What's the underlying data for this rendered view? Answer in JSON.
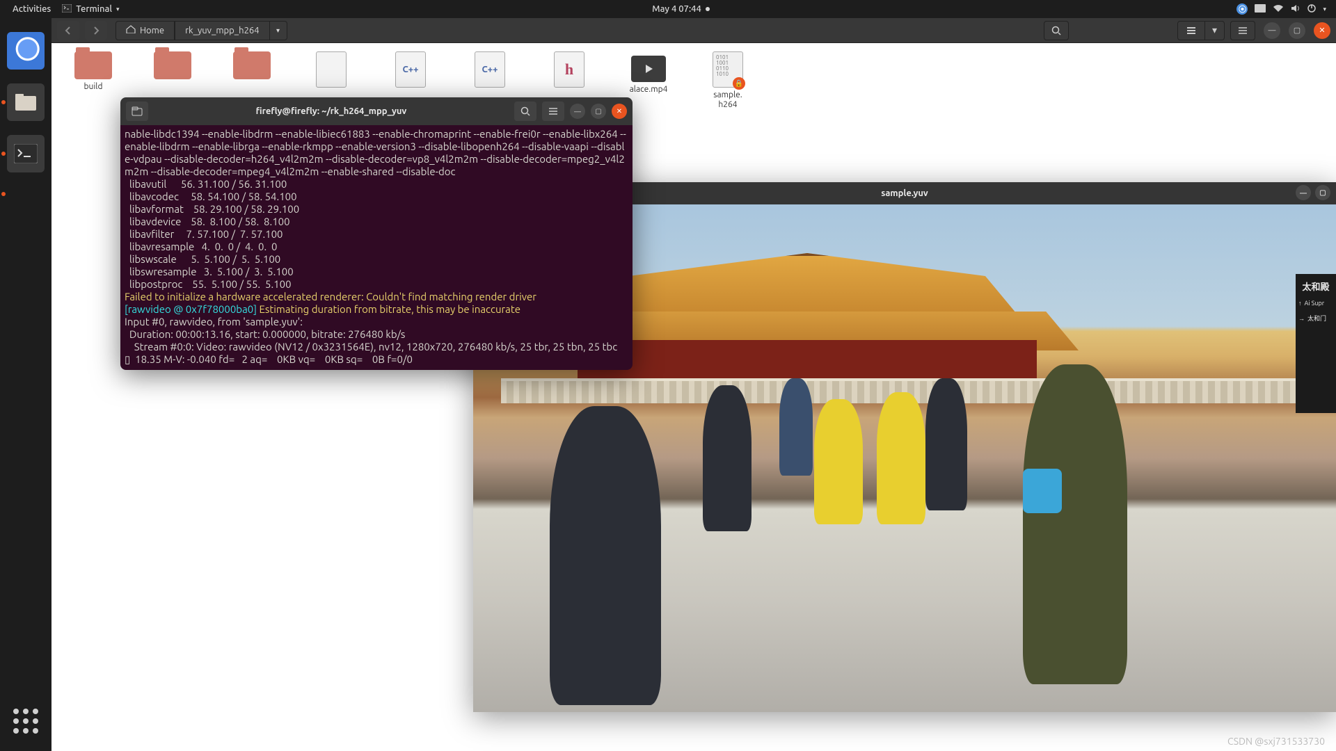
{
  "panel": {
    "activities": "Activities",
    "app_menu": "Terminal",
    "clock": "May 4  07:44"
  },
  "fm": {
    "home_label": "Home",
    "path_label": "rk_yuv_mpp_h264",
    "files": [
      {
        "name": "build",
        "kind": "folder"
      },
      {
        "name": "",
        "kind": "folder"
      },
      {
        "name": "",
        "kind": "folder"
      },
      {
        "name": "",
        "kind": "doc",
        "badge": ""
      },
      {
        "name": "",
        "kind": "cpp",
        "badge": "C++"
      },
      {
        "name": "",
        "kind": "cpp",
        "badge": "C++"
      },
      {
        "name": "",
        "kind": "h",
        "badge": "h"
      },
      {
        "name": "alace.mp4",
        "kind": "video"
      },
      {
        "name": "sample.\nh264",
        "kind": "bin"
      }
    ]
  },
  "terminal": {
    "title": "firefly@firefly: ~/rk_h264_mpp_yuv",
    "lines": [
      {
        "c": "",
        "t": "nable-libdc1394 --enable-libdrm --enable-libiec61883 --enable-chromaprint --enable-frei0r --enable-libx264 --enable-libdrm --enable-librga --enable-rkmpp --enable-version3 --disable-libopenh264 --disable-vaapi --disable-vdpau --disable-decoder=h264_v4l2m2m --disable-decoder=vp8_v4l2m2m --disable-decoder=mpeg2_v4l2m2m --disable-decoder=mpeg4_v4l2m2m --enable-shared --disable-doc"
      },
      {
        "c": "",
        "t": "  libavutil      56. 31.100 / 56. 31.100"
      },
      {
        "c": "",
        "t": "  libavcodec     58. 54.100 / 58. 54.100"
      },
      {
        "c": "",
        "t": "  libavformat    58. 29.100 / 58. 29.100"
      },
      {
        "c": "",
        "t": "  libavdevice    58.  8.100 / 58.  8.100"
      },
      {
        "c": "",
        "t": "  libavfilter     7. 57.100 /  7. 57.100"
      },
      {
        "c": "",
        "t": "  libavresample   4.  0.  0 /  4.  0.  0"
      },
      {
        "c": "",
        "t": "  libswscale      5.  5.100 /  5.  5.100"
      },
      {
        "c": "",
        "t": "  libswresample   3.  5.100 /  3.  5.100"
      },
      {
        "c": "",
        "t": "  libpostproc    55.  5.100 / 55.  5.100"
      },
      {
        "c": "y",
        "t": "Failed to initialize a hardware accelerated renderer: Couldn't find matching render driver"
      },
      {
        "c": "mix",
        "prefix": "[rawvideo @ 0x7f78000ba0] ",
        "t": "Estimating duration from bitrate, this may be inaccurate"
      },
      {
        "c": "",
        "t": "Input #0, rawvideo, from 'sample.yuv':"
      },
      {
        "c": "",
        "t": "  Duration: 00:00:13.16, start: 0.000000, bitrate: 276480 kb/s"
      },
      {
        "c": "",
        "t": "    Stream #0:0: Video: rawvideo (NV12 / 0x3231564E), nv12, 1280x720, 276480 kb/s, 25 tbr, 25 tbn, 25 tbc"
      },
      {
        "c": "",
        "t": "▯  18.35 M-V: -0.040 fd=   2 aq=    0KB vq=    0KB sq=    0B f=0/0"
      }
    ]
  },
  "player": {
    "title": "sample.yuv",
    "sign": {
      "title": "太和殿",
      "l1": "Ai Supr",
      "l2": "太和门"
    }
  },
  "watermark": "CSDN @sxj731533730"
}
